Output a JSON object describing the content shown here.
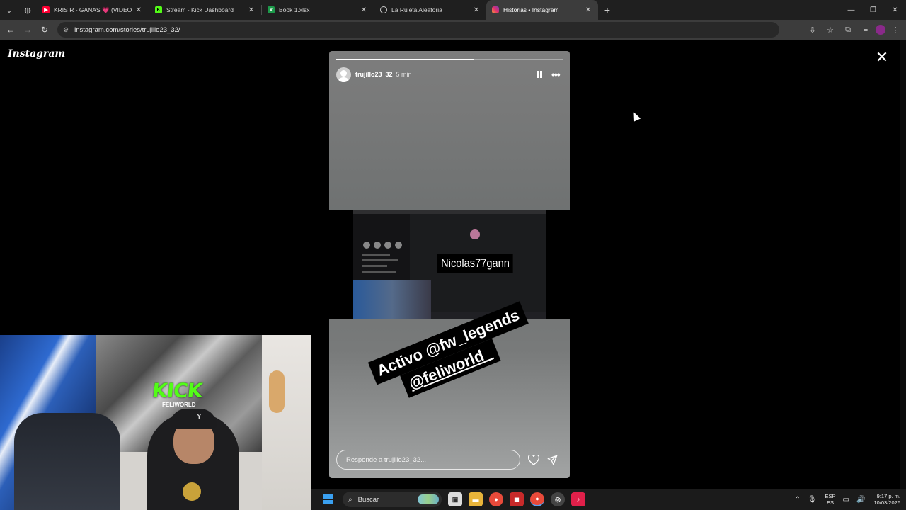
{
  "browser": {
    "tabs": [
      {
        "label": "KRIS R - GANAS 💗 (VIDEO OF",
        "favicon_color": "#ff0033",
        "favicon": "youtube-icon",
        "active": false
      },
      {
        "label": "Stream - Kick Dashboard",
        "favicon_color": "#53fc18",
        "favicon": "kick-icon",
        "active": false
      },
      {
        "label": "Book 1.xlsx",
        "favicon_color": "#1d9a4a",
        "favicon": "excel-icon",
        "active": false
      },
      {
        "label": "La Ruleta Aleatoria",
        "favicon_color": "#cccccc",
        "favicon": "globe-icon",
        "active": false
      },
      {
        "label": "Historias • Instagram",
        "favicon_color": "#e1306c",
        "favicon": "instagram-icon",
        "active": true
      }
    ],
    "url": "instagram.com/stories/trujillo23_32/"
  },
  "instagram": {
    "logo": "Instagram",
    "story": {
      "username": "trujillo23_32",
      "time_ago": "5 min",
      "progress": 0.61,
      "sticker_name": "Nicolas77gann",
      "caption_line1": "Activo @fw_legends",
      "caption_line2": "@feliworld_",
      "reply_placeholder": "Responde a trujillo23_32..."
    }
  },
  "webcam": {
    "kick_text": "KICK",
    "feli_text": "FELIWORLD"
  },
  "taskbar": {
    "search_label": "Buscar",
    "lang_top": "ESP",
    "lang_bottom": "ES",
    "time": "9:17 p. m.",
    "date": "10/03/2026"
  },
  "colors": {
    "browser_bg": "#1f1f1f",
    "toolbar_bg": "#3c3c3c",
    "page_bg": "#000000",
    "kick_green": "#53fc18"
  }
}
